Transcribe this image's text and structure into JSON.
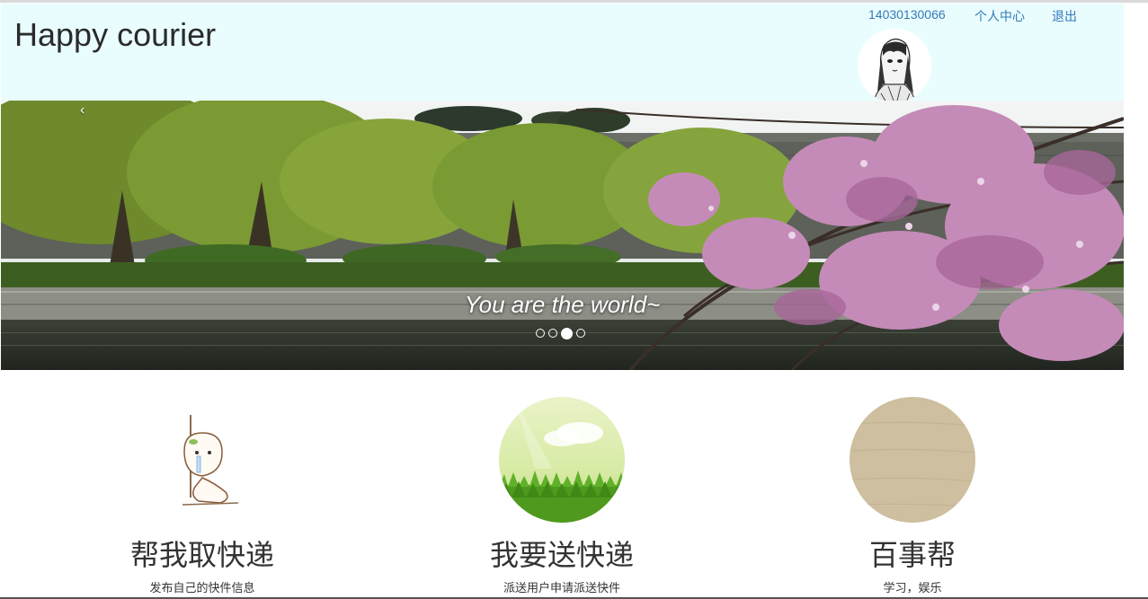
{
  "header": {
    "brand": "Happy courier",
    "nav": {
      "user_id": "14030130066",
      "profile": "个人中心",
      "logout": "退出"
    }
  },
  "carousel": {
    "prev_glyph": "‹",
    "caption": "You are the world~",
    "slide_count": 4,
    "active_index": 2
  },
  "features": [
    {
      "title": "帮我取快递",
      "desc": "发布自己的快件信息",
      "icon": "cartoon-character-icon"
    },
    {
      "title": "我要送快递",
      "desc": "派送用户申请派送快件",
      "icon": "grass-meadow-icon"
    },
    {
      "title": "百事帮",
      "desc": "学习，娱乐",
      "icon": "wood-texture-icon"
    }
  ],
  "colors": {
    "header_bg": "#e9fdff",
    "link": "#337ab7",
    "wood": "#cdbf9f"
  }
}
